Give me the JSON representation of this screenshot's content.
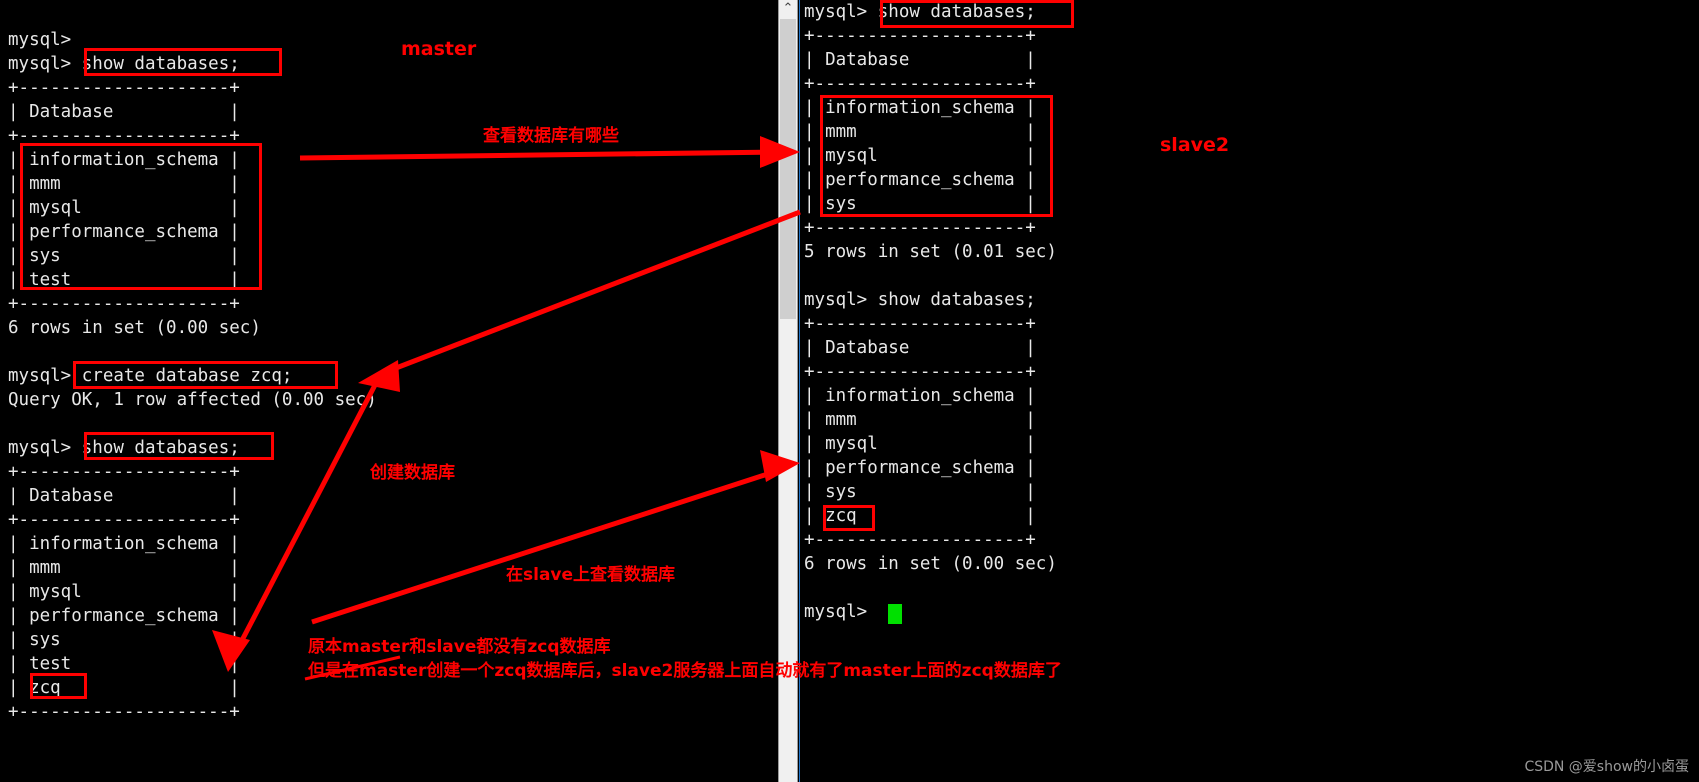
{
  "left_terminal": {
    "name": "master-mysql-terminal",
    "lines": [
      "",
      "mysql>",
      "mysql> show databases;",
      "+--------------------+",
      "| Database           |",
      "+--------------------+",
      "| information_schema |",
      "| mmm                |",
      "| mysql              |",
      "| performance_schema |",
      "| sys                |",
      "| test               |",
      "+--------------------+",
      "6 rows in set (0.00 sec)",
      "",
      "mysql> create database zcq;",
      "Query OK, 1 row affected (0.00 sec)",
      "",
      "mysql> show databases;",
      "+--------------------+",
      "| Database           |",
      "+--------------------+",
      "| information_schema |",
      "| mmm                |",
      "| mysql              |",
      "| performance_schema |",
      "| sys                |",
      "| test               |",
      "| zcq                |",
      "+--------------------+"
    ]
  },
  "right_terminal": {
    "name": "slave2-mysql-terminal",
    "lines": [
      "mysql> show databases;",
      "+--------------------+",
      "| Database           |",
      "+--------------------+",
      "| information_schema |",
      "| mmm                |",
      "| mysql              |",
      "| performance_schema |",
      "| sys                |",
      "+--------------------+",
      "5 rows in set (0.01 sec)",
      "",
      "mysql> show databases;",
      "+--------------------+",
      "| Database           |",
      "+--------------------+",
      "| information_schema |",
      "| mmm                |",
      "| mysql              |",
      "| performance_schema |",
      "| sys                |",
      "| zcq                |",
      "+--------------------+",
      "6 rows in set (0.00 sec)",
      "",
      "mysql> "
    ]
  },
  "annotations": {
    "master_label": "master",
    "slave2_label": "slave2",
    "note_show_databases": "查看数据库有哪些",
    "note_create_database": "创建数据库",
    "note_check_on_slave": "在slave上查看数据库",
    "summary_line1": "原本master和slave都没有zcq数据库",
    "summary_line2": "但是在master创建一个zcq数据库后，slave2服务器上面自动就有了master上面的zcq数据库了"
  },
  "scrollbar": {
    "up_arrow": "⌃"
  },
  "watermark": "CSDN @爱show的小卤蛋",
  "colors": {
    "annotation_red": "#ff0000",
    "terminal_bg": "#000000",
    "terminal_fg": "#e8e8e8",
    "cursor_green": "#00e000"
  }
}
